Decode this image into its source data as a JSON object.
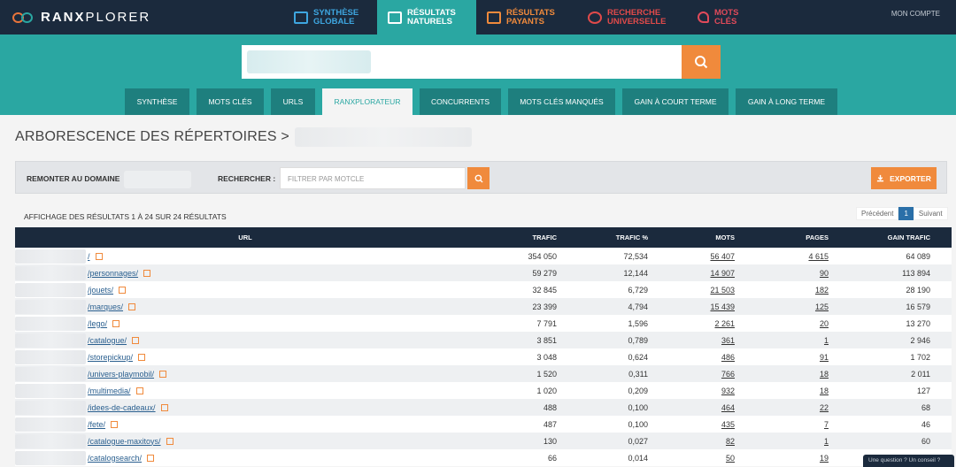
{
  "app": {
    "logo_bold": "RANX",
    "logo_light": "PLORER",
    "nav": [
      {
        "line1": "SYNTHÈSE",
        "line2": "GLOBALE"
      },
      {
        "line1": "RÉSULTATS",
        "line2": "NATURELS"
      },
      {
        "line1": "RÉSULTATS",
        "line2": "PAYANTS"
      },
      {
        "line1": "RECHERCHE",
        "line2": "UNIVERSELLE"
      },
      {
        "line1": "MOTS",
        "line2": "CLÉS"
      }
    ],
    "account": "MON COMPTE"
  },
  "tabs": [
    "SYNTHÈSE",
    "MOTS CLÉS",
    "URLS",
    "RANXPLORATEUR",
    "CONCURRENTS",
    "MOTS CLÉS MANQUÉS",
    "GAIN À COURT TERME",
    "GAIN À LONG TERME"
  ],
  "title": "ARBORESCENCE DES RÉPERTOIRES >",
  "filter": {
    "remonter": "REMONTER AU DOMAINE",
    "rechercher": "RECHERCHER :",
    "placeholder": "FILTRER PAR MOTCLE",
    "export": "EXPORTER"
  },
  "results_text": "AFFICHAGE DES RÉSULTATS 1 À 24 SUR 24 RÉSULTATS",
  "pager": {
    "prev": "Précédent",
    "current": "1",
    "next": "Suivant"
  },
  "table": {
    "headers": [
      "URL",
      "TRAFIC",
      "TRAFIC %",
      "MOTS",
      "PAGES",
      "GAIN TRAFIC"
    ],
    "rows": [
      {
        "url": "/",
        "trafic": "354 050",
        "pct": "72,534",
        "mots": "56 407",
        "pages": "4 615",
        "gain": "64 089"
      },
      {
        "url": "/personnages/",
        "trafic": "59 279",
        "pct": "12,144",
        "mots": "14 907",
        "pages": "90",
        "gain": "113 894"
      },
      {
        "url": "/jouets/",
        "trafic": "32 845",
        "pct": "6,729",
        "mots": "21 503",
        "pages": "182",
        "gain": "28 190"
      },
      {
        "url": "/marques/",
        "trafic": "23 399",
        "pct": "4,794",
        "mots": "15 439",
        "pages": "125",
        "gain": "16 579"
      },
      {
        "url": "/lego/",
        "trafic": "7 791",
        "pct": "1,596",
        "mots": "2 261",
        "pages": "20",
        "gain": "13 270"
      },
      {
        "url": "/catalogue/",
        "trafic": "3 851",
        "pct": "0,789",
        "mots": "361",
        "pages": "1",
        "gain": "2 946"
      },
      {
        "url": "/storepickup/",
        "trafic": "3 048",
        "pct": "0,624",
        "mots": "486",
        "pages": "91",
        "gain": "1 702"
      },
      {
        "url": "/univers-playmobil/",
        "trafic": "1 520",
        "pct": "0,311",
        "mots": "766",
        "pages": "18",
        "gain": "2 011"
      },
      {
        "url": "/multimedia/",
        "trafic": "1 020",
        "pct": "0,209",
        "mots": "932",
        "pages": "18",
        "gain": "127"
      },
      {
        "url": "/idees-de-cadeaux/",
        "trafic": "488",
        "pct": "0,100",
        "mots": "464",
        "pages": "22",
        "gain": "68"
      },
      {
        "url": "/fete/",
        "trafic": "487",
        "pct": "0,100",
        "mots": "435",
        "pages": "7",
        "gain": "46"
      },
      {
        "url": "/catalogue-maxitoys/",
        "trafic": "130",
        "pct": "0,027",
        "mots": "82",
        "pages": "1",
        "gain": "60"
      },
      {
        "url": "/catalogsearch/",
        "trafic": "66",
        "pct": "0,014",
        "mots": "50",
        "pages": "19",
        "gain": ""
      }
    ]
  },
  "chat": "Une question ? Un conseil ?"
}
